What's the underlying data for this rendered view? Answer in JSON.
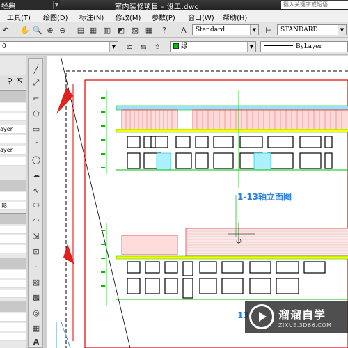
{
  "titlebar": {
    "left_label": "经典",
    "title": "室内装修项目 - 设工.dwg",
    "search_placeholder": "键入关键字或短语"
  },
  "menubar": {
    "items": [
      "工具(T)",
      "绘图(D)",
      "标注(N)",
      "修改(M)",
      "参数(P)",
      "窗口(W)",
      "帮助(H)"
    ]
  },
  "toolbar1": {
    "text_style": "Standard",
    "dim_style": "STANDARD"
  },
  "toolbar2": {
    "layer_value": "0",
    "color_value": "绿",
    "linetype_value": "ByLayer"
  },
  "palette": {
    "rows": [
      "ayer",
      "ayer",
      "影"
    ]
  },
  "drawing": {
    "elevation_label": "1-13轴立面图",
    "elevation_label_bottom": "13"
  },
  "watermark": {
    "brand": "溜溜自学",
    "url": "ZIXUE.3D66.COM"
  },
  "colors": {
    "accent_red": "#e0201c",
    "frame_red": "#e60000",
    "label_blue": "#2a7fe0",
    "drawing_green": "#00c000",
    "drawing_yellow": "#ffff00"
  }
}
